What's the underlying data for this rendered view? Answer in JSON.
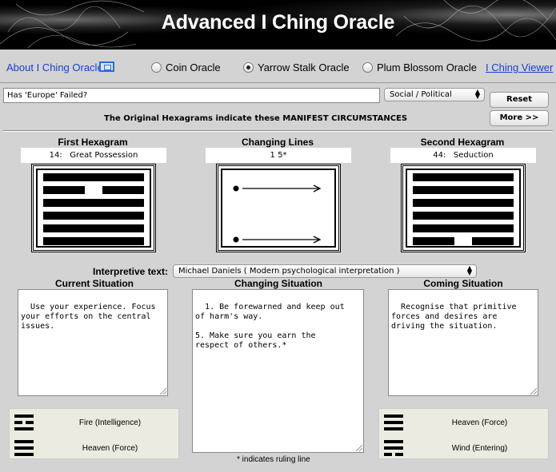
{
  "app": {
    "title": "Advanced I Ching Oracle"
  },
  "nav": {
    "about_link": "About I Ching Oracle",
    "options": [
      {
        "label": "Coin Oracle",
        "selected": false
      },
      {
        "label": "Yarrow Stalk Oracle",
        "selected": true
      },
      {
        "label": "Plum Blossom Oracle",
        "selected": false
      }
    ],
    "viewer_link": "I Ching Viewer"
  },
  "query": {
    "question": "Has 'Europe' Failed?",
    "category": "Social / Political",
    "reset_label": "Reset",
    "more_label": "More >>",
    "manifest_text": "The Original Hexagrams indicate these MANIFEST CIRCUMSTANCES"
  },
  "first": {
    "title": "First Hexagram",
    "number": "14:",
    "name": "Great Possession",
    "lines": [
      "yang",
      "yin",
      "yang",
      "yang",
      "yang",
      "yang"
    ]
  },
  "changing": {
    "title": "Changing Lines",
    "label": "1   5*"
  },
  "second": {
    "title": "Second Hexagram",
    "number": "44:",
    "name": "Seduction",
    "lines": [
      "yang",
      "yang",
      "yang",
      "yang",
      "yang",
      "yin"
    ]
  },
  "interpretive": {
    "label": "Interpretive text:",
    "source": "Michael Daniels ( Modern psychological interpretation )"
  },
  "situations": {
    "current_title": "Current Situation",
    "current_text": "Use your experience. Focus\nyour efforts on the central\nissues.",
    "changing_title": "Changing Situation",
    "changing_text": "1. Be forewarned and keep out\nof harm's way.\n\n5. Make sure you earn the\nrespect of others.*",
    "coming_title": "Coming Situation",
    "coming_text": "Recognise that primitive\nforces and desires are\ndriving the situation."
  },
  "trigrams_left": [
    {
      "name": "Fire (Intelligence)",
      "icon": "trigram-fire-icon"
    },
    {
      "name": "Heaven (Force)",
      "icon": "trigram-heaven-icon"
    }
  ],
  "trigrams_right": [
    {
      "name": "Heaven (Force)",
      "icon": "trigram-heaven-icon"
    },
    {
      "name": "Wind (Entering)",
      "icon": "trigram-wind-icon"
    }
  ],
  "footnote": "* indicates ruling line"
}
